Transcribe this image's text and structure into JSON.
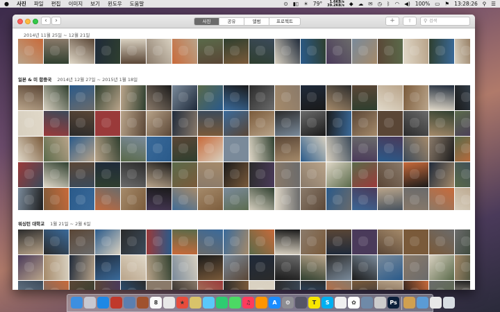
{
  "menubar": {
    "app_name": "사진",
    "items": [
      "파일",
      "편집",
      "이미지",
      "보기",
      "윈도우",
      "도움말"
    ],
    "temperature": "79°",
    "net_up": "1.6KB/s",
    "net_down": "39.2KB/s",
    "battery": "100%",
    "clock": "13:28:26"
  },
  "toolbar": {
    "tabs": [
      {
        "label": "사진",
        "active": true
      },
      {
        "label": "공유",
        "active": false
      },
      {
        "label": "앨범",
        "active": false
      },
      {
        "label": "프로젝트",
        "active": false
      }
    ],
    "search_placeholder": "검색"
  },
  "sections": [
    {
      "place": "",
      "date": "2014년 11월 25일 ~ 12월 21일",
      "rows": 1
    },
    {
      "place": "일본 & 미 합중국",
      "date": "2014년 12월 27일 ~ 2015년 1월 18일",
      "rows": 5
    },
    {
      "place": "워싱턴 대학교",
      "date": "1월 21일 ~ 2월 6일",
      "rows": 3
    }
  ],
  "dock": {
    "apps": [
      {
        "name": "finder-icon",
        "color": "#3d8fe0",
        "glyph": ""
      },
      {
        "name": "launchpad-icon",
        "color": "#c8c8d0",
        "glyph": ""
      },
      {
        "name": "safari-icon",
        "color": "#1e88e5",
        "glyph": ""
      },
      {
        "name": "rocket-app-icon",
        "color": "#c0392b",
        "glyph": ""
      },
      {
        "name": "preview-icon",
        "color": "#5b7fb0",
        "glyph": ""
      },
      {
        "name": "books-icon",
        "color": "#a0522d",
        "glyph": ""
      },
      {
        "name": "calendar-icon",
        "color": "#fafafa",
        "glyph": "8"
      },
      {
        "name": "reminders-icon",
        "color": "#e8e8e8",
        "glyph": ""
      },
      {
        "name": "flag-app-icon",
        "color": "#e74c3c",
        "glyph": "★"
      },
      {
        "name": "notes-icon",
        "color": "#d9c36a",
        "glyph": ""
      },
      {
        "name": "messages-icon",
        "color": "#5ac8fa",
        "glyph": ""
      },
      {
        "name": "facetime-icon",
        "color": "#2ecc71",
        "glyph": ""
      },
      {
        "name": "phone-icon",
        "color": "#4cd964",
        "glyph": ""
      },
      {
        "name": "music-icon",
        "color": "#ff3b5c",
        "glyph": "♫"
      },
      {
        "name": "ibooks-icon",
        "color": "#ff9500",
        "glyph": ""
      },
      {
        "name": "app-store-icon",
        "color": "#1a8cff",
        "glyph": "A"
      },
      {
        "name": "system-prefs-icon",
        "color": "#8e8e93",
        "glyph": "⚙"
      },
      {
        "name": "spark-icon",
        "color": "#555566",
        "glyph": ""
      },
      {
        "name": "kakaotalk-icon",
        "color": "#f7e600",
        "glyph": "T"
      },
      {
        "name": "skype-icon",
        "color": "#00aff0",
        "glyph": "S"
      },
      {
        "name": "textedit-icon",
        "color": "#f0f0f0",
        "glyph": ""
      },
      {
        "name": "photos-app-icon",
        "color": "#ffffff",
        "glyph": "✿"
      },
      {
        "name": "archive-icon",
        "color": "#6f8aa8",
        "glyph": ""
      },
      {
        "name": "utility-icon",
        "color": "#cccccc",
        "glyph": ""
      },
      {
        "name": "photoshop-icon",
        "color": "#0b1f3a",
        "glyph": "Ps"
      }
    ],
    "folders": [
      {
        "name": "applications-folder-icon",
        "color": "#d0a050",
        "glyph": ""
      },
      {
        "name": "downloads-folder-icon",
        "color": "#5b9bd5",
        "glyph": ""
      },
      {
        "name": "documents-stack-icon",
        "color": "#e8e8e8",
        "glyph": ""
      },
      {
        "name": "trash-icon",
        "color": "#d8dde3",
        "glyph": ""
      }
    ]
  }
}
